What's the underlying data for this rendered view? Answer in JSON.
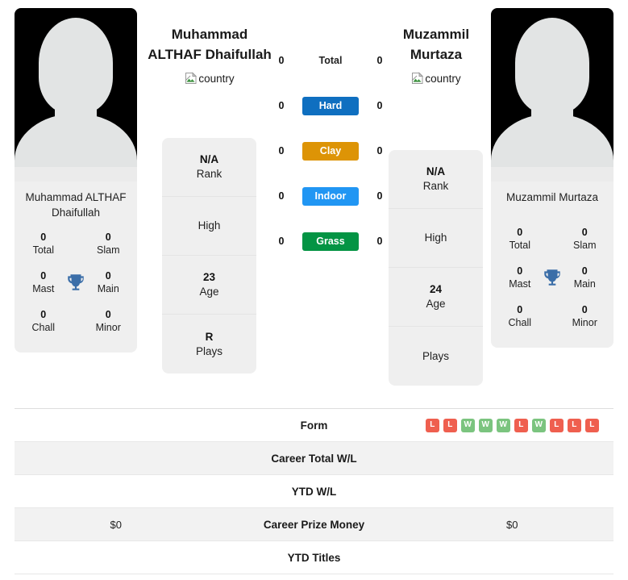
{
  "players": {
    "left": {
      "display_name_line1": "Muhammad",
      "display_name_line2": "ALTHAF Dhaifullah",
      "flag_alt": "country",
      "card_name": "Muhammad ALTHAF Dhaifullah",
      "titles": {
        "total_value": "0",
        "total_label": "Total",
        "slam_value": "0",
        "slam_label": "Slam",
        "mast_value": "0",
        "mast_label": "Mast",
        "main_value": "0",
        "main_label": "Main",
        "chall_value": "0",
        "chall_label": "Chall",
        "minor_value": "0",
        "minor_label": "Minor"
      },
      "info": [
        {
          "value": "N/A",
          "label": "Rank"
        },
        {
          "value": "",
          "label": "High"
        },
        {
          "value": "23",
          "label": "Age"
        },
        {
          "value": "R",
          "label": "Plays"
        }
      ],
      "surface_wins": {
        "total": "0",
        "hard": "0",
        "clay": "0",
        "indoor": "0",
        "grass": "0"
      },
      "career_prize_money": "$0",
      "career_total_wl": "",
      "ytd_wl": "",
      "ytd_titles": ""
    },
    "right": {
      "display_name_line1": "Muzammil",
      "display_name_line2": "Murtaza",
      "flag_alt": "country",
      "card_name": "Muzammil Murtaza",
      "titles": {
        "total_value": "0",
        "total_label": "Total",
        "slam_value": "0",
        "slam_label": "Slam",
        "mast_value": "0",
        "mast_label": "Mast",
        "main_value": "0",
        "main_label": "Main",
        "chall_value": "0",
        "chall_label": "Chall",
        "minor_value": "0",
        "minor_label": "Minor"
      },
      "info": [
        {
          "value": "N/A",
          "label": "Rank"
        },
        {
          "value": "",
          "label": "High"
        },
        {
          "value": "24",
          "label": "Age"
        },
        {
          "value": "",
          "label": "Plays"
        }
      ],
      "surface_wins": {
        "total": "0",
        "hard": "0",
        "clay": "0",
        "indoor": "0",
        "grass": "0"
      },
      "career_prize_money": "$0",
      "career_total_wl": "",
      "ytd_wl": "",
      "ytd_titles": ""
    }
  },
  "surfaces": [
    {
      "key": "total",
      "label": "Total",
      "color": "transparent",
      "bar": false
    },
    {
      "key": "hard",
      "label": "Hard",
      "color": "#0f6fc0",
      "bar": true
    },
    {
      "key": "clay",
      "label": "Clay",
      "color": "#dd9406",
      "bar": true
    },
    {
      "key": "indoor",
      "label": "Indoor",
      "color": "#2196f3",
      "bar": true
    },
    {
      "key": "grass",
      "label": "Grass",
      "color": "#049444",
      "bar": true
    }
  ],
  "table": {
    "rows": [
      {
        "label": "Form",
        "left": "",
        "right": "",
        "type": "form"
      },
      {
        "label": "Career Total W/L",
        "left": "",
        "right": "",
        "type": "text"
      },
      {
        "label": "YTD W/L",
        "left": "",
        "right": "",
        "type": "text"
      },
      {
        "label": "Career Prize Money",
        "left": "$0",
        "right": "$0",
        "type": "text"
      },
      {
        "label": "YTD Titles",
        "left": "",
        "right": "",
        "type": "text"
      }
    ],
    "form_left": [],
    "form_right": [
      "L",
      "L",
      "W",
      "W",
      "W",
      "L",
      "W",
      "L",
      "L",
      "L"
    ]
  },
  "colors": {
    "win_badge": "#ef5f4f",
    "loss_badge": "#7bc47f",
    "trophy": "#3b6ea8",
    "card_bg": "#efefef",
    "row_alt_bg": "#f2f2f2"
  }
}
